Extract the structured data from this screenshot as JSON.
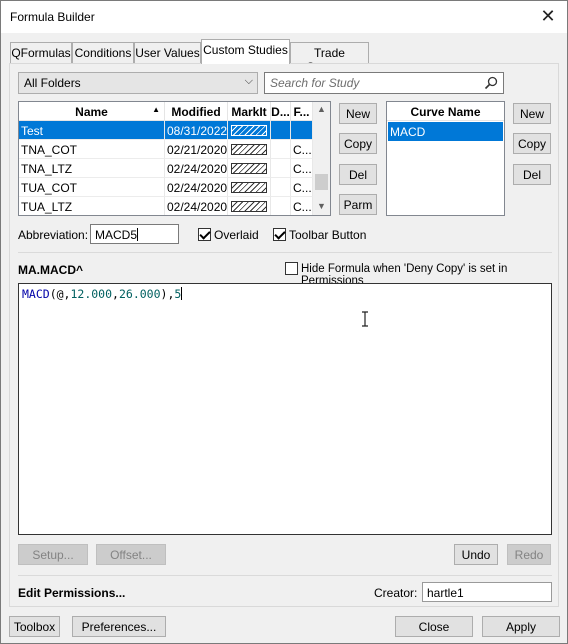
{
  "window": {
    "title": "Formula Builder"
  },
  "tabs": [
    "QFormulas",
    "Conditions",
    "User Values",
    "Custom Studies",
    "Trade Systems"
  ],
  "folder_select": {
    "value": "All Folders"
  },
  "search": {
    "placeholder": "Search for Study"
  },
  "study_table": {
    "columns": [
      "Name",
      "Modified",
      "MarkIt",
      "D...",
      "F..."
    ],
    "rows": [
      {
        "name": "Test",
        "modified": "08/31/2022",
        "f": ""
      },
      {
        "name": "TNA_COT",
        "modified": "02/21/2020",
        "f": "C..."
      },
      {
        "name": "TNA_LTZ",
        "modified": "02/24/2020",
        "f": "C..."
      },
      {
        "name": "TUA_COT",
        "modified": "02/24/2020",
        "f": "C..."
      },
      {
        "name": "TUA_LTZ",
        "modified": "02/24/2020",
        "f": "C..."
      }
    ]
  },
  "study_buttons": {
    "new": "New",
    "copy": "Copy",
    "del": "Del",
    "parm": "Parm"
  },
  "curve_table": {
    "header": "Curve Name",
    "rows": [
      "MACD"
    ]
  },
  "curve_buttons": {
    "new": "New",
    "copy": "Copy",
    "del": "Del"
  },
  "abbreviation": {
    "label": "Abbreviation:",
    "value": "MACD5"
  },
  "overlaid": {
    "label": "Overlaid",
    "checked": true
  },
  "toolbar_button": {
    "label": "Toolbar Button",
    "checked": true
  },
  "formula_name": "MA.MACD^",
  "hide_formula": {
    "label": "Hide Formula when 'Deny Copy' is set in Permissions",
    "checked": false
  },
  "formula": {
    "fn": "MACD",
    "open": "(@,",
    "n1": "12.000",
    "comma": ",",
    "n2": "26.000",
    "close": "),",
    "n3": "5"
  },
  "editor_buttons": {
    "setup": "Setup...",
    "offset": "Offset...",
    "undo": "Undo",
    "redo": "Redo"
  },
  "permissions": {
    "label": "Edit Permissions..."
  },
  "creator": {
    "label": "Creator:",
    "value": "hartle1"
  },
  "footer": {
    "toolbox": "Toolbox",
    "preferences": "Preferences...",
    "close": "Close",
    "apply": "Apply"
  }
}
